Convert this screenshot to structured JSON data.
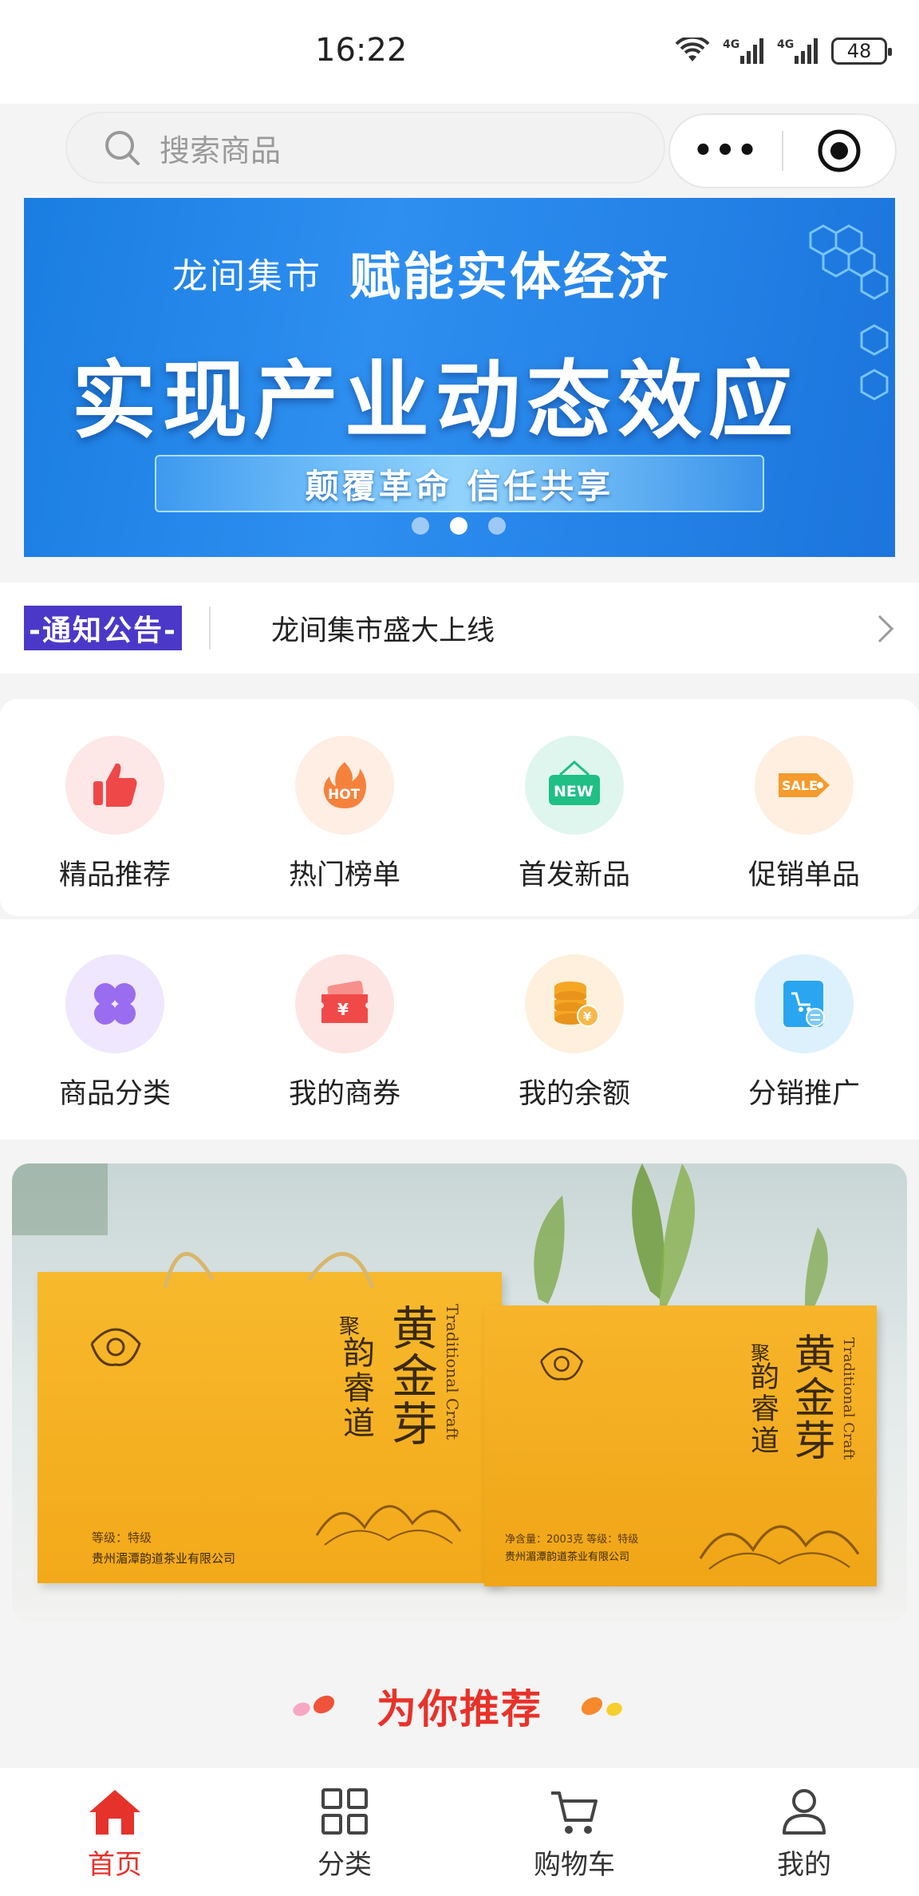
{
  "status_bar": {
    "time": "16:22",
    "battery": "48",
    "network1": "4G",
    "network2": "4G",
    "wifi_sub": "6"
  },
  "search": {
    "placeholder": "搜索商品"
  },
  "banner": {
    "brand": "龙间集市",
    "headline_small": "赋能实体经济",
    "headline_large": "实现产业动态效应",
    "pill_text": "颠覆革命  信任共享",
    "slides": 3,
    "active_slide": 2
  },
  "notice": {
    "tag": "-通知公告-",
    "text": "龙间集市盛大上线"
  },
  "grid_row1": [
    {
      "label": "精品推荐",
      "icon": "thumbs-up-icon",
      "color": "#f04848"
    },
    {
      "label": "热门榜单",
      "icon": "hot-fire-icon",
      "color": "#f5823c"
    },
    {
      "label": "首发新品",
      "icon": "new-sign-icon",
      "color": "#1fbf86"
    },
    {
      "label": "促销单品",
      "icon": "sale-tag-icon",
      "color": "#f59a2c"
    }
  ],
  "grid_row2": [
    {
      "label": "商品分类",
      "icon": "category-clover-icon",
      "color": "#9a6cf0"
    },
    {
      "label": "我的商券",
      "icon": "coupon-icon",
      "color": "#f04a48"
    },
    {
      "label": "我的余额",
      "icon": "coin-stack-icon",
      "color": "#f5a623"
    },
    {
      "label": "分销推广",
      "icon": "distribution-icon",
      "color": "#2aa5ef"
    }
  ],
  "promo": {
    "product_name": "黄金芽",
    "brand_prefix": "聚",
    "brand_name": "韵睿道",
    "craft_text": "Traditional Craft",
    "grade": "等级：特级",
    "company": "贵州湄潭韵道茶业有限公司",
    "box_net": "净含量：2003克  等级：特级",
    "box_company": "贵州湄潭韵道茶业有限公司"
  },
  "recommend": {
    "title": "为你推荐"
  },
  "tabbar": [
    {
      "label": "首页",
      "icon": "home-icon",
      "active": true
    },
    {
      "label": "分类",
      "icon": "grid-icon",
      "active": false
    },
    {
      "label": "购物车",
      "icon": "cart-icon",
      "active": false
    },
    {
      "label": "我的",
      "icon": "user-icon",
      "active": false
    }
  ],
  "colors": {
    "accent": "#e5322b",
    "notice_tag": "#4b38c8",
    "banner_blue": "#1f82e6"
  }
}
